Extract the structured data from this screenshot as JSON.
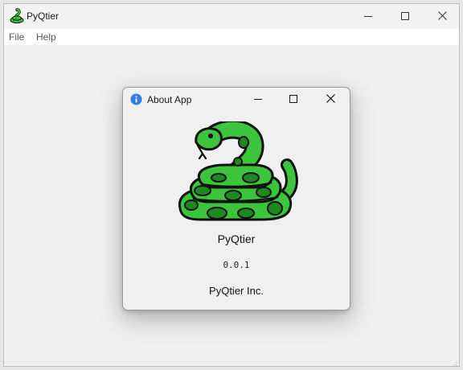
{
  "main_window": {
    "title": "PyQtier",
    "icon": "snake-icon",
    "controls": [
      "minimize-icon",
      "maximize-icon",
      "close-icon"
    ]
  },
  "menubar": {
    "items": [
      {
        "label": "File"
      },
      {
        "label": "Help"
      }
    ]
  },
  "about_dialog": {
    "title": "About App",
    "icon": "info-icon",
    "logo": "snake-logo",
    "app_name": "PyQtier",
    "version": "0.0.1",
    "company": "PyQtier Inc.",
    "controls": [
      "minimize-icon",
      "maximize-icon",
      "close-icon"
    ]
  },
  "colors": {
    "snake_green": "#3cc43c",
    "snake_dark": "#1e8a1e",
    "outline": "#111111",
    "info_blue": "#2f7ee8"
  }
}
